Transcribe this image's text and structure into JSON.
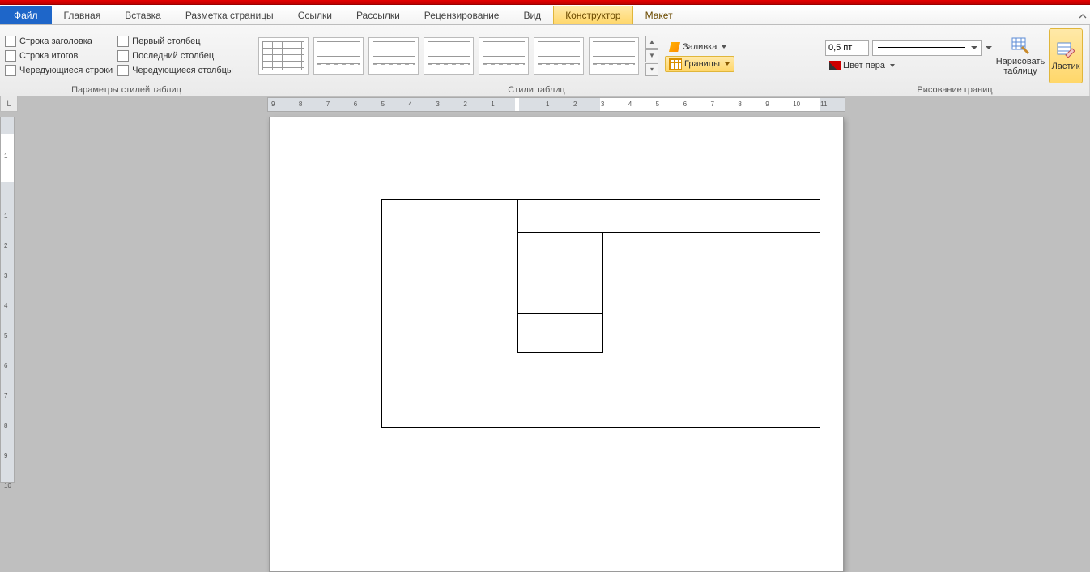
{
  "tabs": {
    "file": "Файл",
    "items": [
      "Главная",
      "Вставка",
      "Разметка страницы",
      "Ссылки",
      "Рассылки",
      "Рецензирование",
      "Вид"
    ],
    "context": [
      "Конструктор",
      "Макет"
    ],
    "active_context": 0
  },
  "style_options": {
    "group_title": "Параметры стилей таблиц",
    "left": [
      {
        "label": "Строка заголовка",
        "checked": false
      },
      {
        "label": "Строка итогов",
        "checked": false
      },
      {
        "label": "Чередующиеся строки",
        "checked": false
      }
    ],
    "right": [
      {
        "label": "Первый столбец",
        "checked": false
      },
      {
        "label": "Последний столбец",
        "checked": false
      },
      {
        "label": "Чередующиеся столбцы",
        "checked": false
      }
    ]
  },
  "table_styles": {
    "group_title": "Стили таблиц"
  },
  "shading": {
    "label": "Заливка"
  },
  "borders": {
    "label": "Границы"
  },
  "pen": {
    "width": "0,5 пт",
    "color_label": "Цвет пера"
  },
  "draw_borders": {
    "group_title": "Рисование границ",
    "draw": "Нарисовать таблицу",
    "eraser": "Ластик"
  },
  "ruler": {
    "h_marks": [
      "9",
      "8",
      "7",
      "6",
      "5",
      "4",
      "3",
      "2",
      "1",
      "",
      "1",
      "2",
      "3",
      "4",
      "5",
      "6",
      "7",
      "8",
      "9",
      "10",
      "11"
    ],
    "v_marks": [
      "",
      "1",
      "",
      "1",
      "2",
      "3",
      "4",
      "5",
      "6",
      "7",
      "8",
      "9",
      "10"
    ]
  },
  "corner": "L"
}
